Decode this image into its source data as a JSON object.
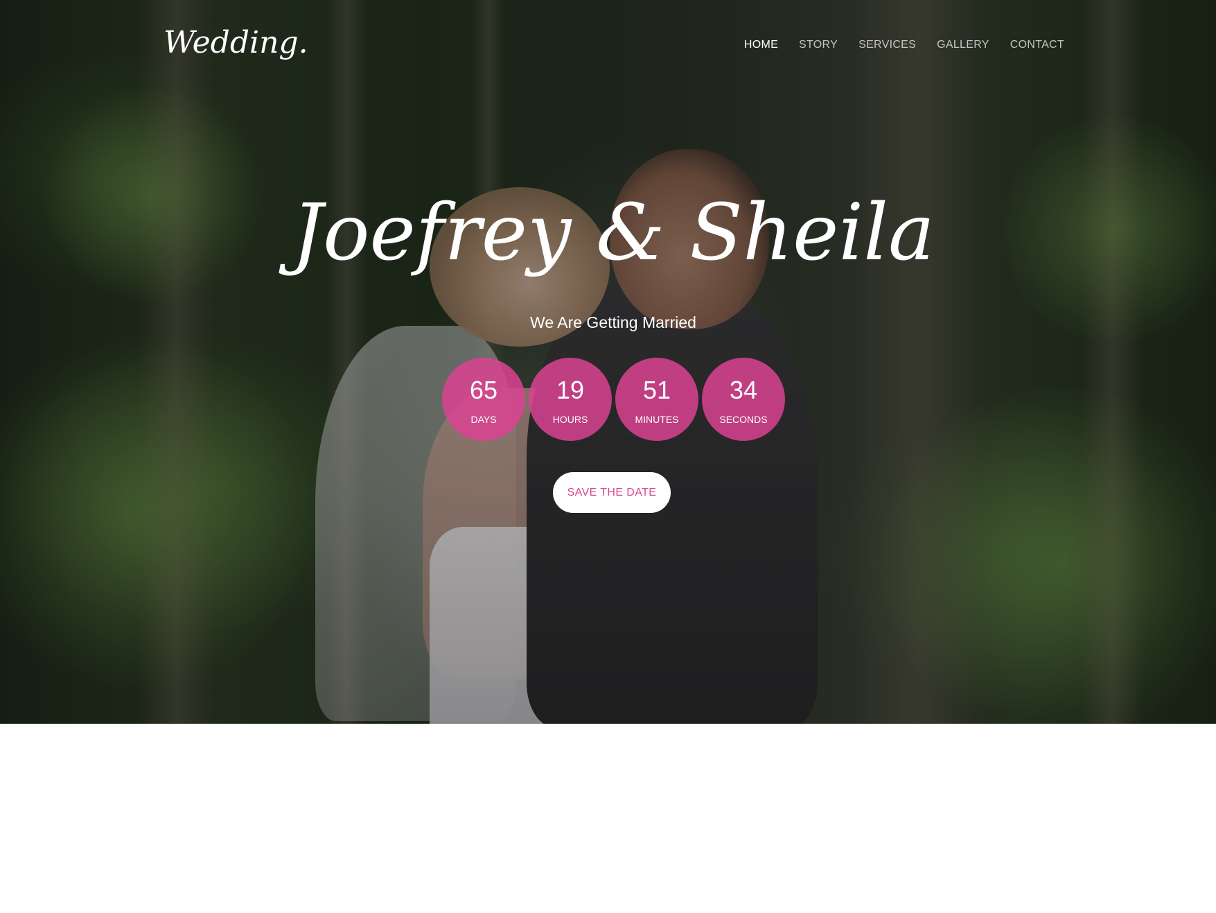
{
  "header": {
    "logo": "Wedding.",
    "nav": [
      {
        "label": "HOME",
        "active": true
      },
      {
        "label": "STORY",
        "active": false
      },
      {
        "label": "SERVICES",
        "active": false
      },
      {
        "label": "GALLERY",
        "active": false
      },
      {
        "label": "CONTACT",
        "active": false
      }
    ]
  },
  "hero": {
    "names": "Joefrey & Sheila",
    "subtitle": "We Are Getting Married",
    "countdown": [
      {
        "value": "65",
        "label": "DAYS"
      },
      {
        "value": "19",
        "label": "HOURS"
      },
      {
        "value": "51",
        "label": "MINUTES"
      },
      {
        "value": "34",
        "label": "SECONDS"
      }
    ],
    "cta": "SAVE THE DATE"
  },
  "colors": {
    "accent": "#db4392",
    "button_text": "#d8488f",
    "background_below": "#ffffff"
  }
}
